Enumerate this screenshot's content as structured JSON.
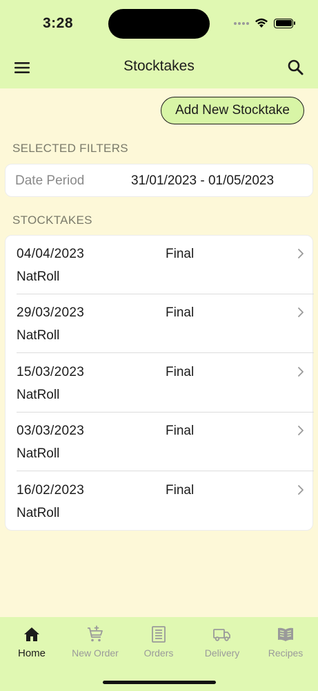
{
  "status_bar": {
    "time": "3:28"
  },
  "nav": {
    "title": "Stocktakes"
  },
  "actions": {
    "add_label": "Add New Stocktake"
  },
  "filters": {
    "section_label": "SELECTED FILTERS",
    "date_label": "Date Period",
    "date_value": "31/01/2023 - 01/05/2023"
  },
  "stocktakes": {
    "section_label": "STOCKTAKES",
    "items": [
      {
        "date": "04/04/2023",
        "status": "Final",
        "name": "NatRoll"
      },
      {
        "date": "29/03/2023",
        "status": "Final",
        "name": "NatRoll"
      },
      {
        "date": "15/03/2023",
        "status": "Final",
        "name": "NatRoll"
      },
      {
        "date": "03/03/2023",
        "status": "Final",
        "name": "NatRoll"
      },
      {
        "date": "16/02/2023",
        "status": "Final",
        "name": "NatRoll"
      }
    ]
  },
  "tabs": [
    {
      "label": "Home",
      "icon": "home-icon",
      "active": true
    },
    {
      "label": "New Order",
      "icon": "cart-add-icon",
      "active": false
    },
    {
      "label": "Orders",
      "icon": "receipt-icon",
      "active": false
    },
    {
      "label": "Delivery",
      "icon": "truck-icon",
      "active": false
    },
    {
      "label": "Recipes",
      "icon": "book-icon",
      "active": false
    }
  ],
  "colors": {
    "header_bg": "#e0f8b2",
    "page_bg": "#fdf8d8",
    "button_bg": "#d8f5a6",
    "card_bg": "#ffffff",
    "muted_text": "#8a8a8a"
  }
}
